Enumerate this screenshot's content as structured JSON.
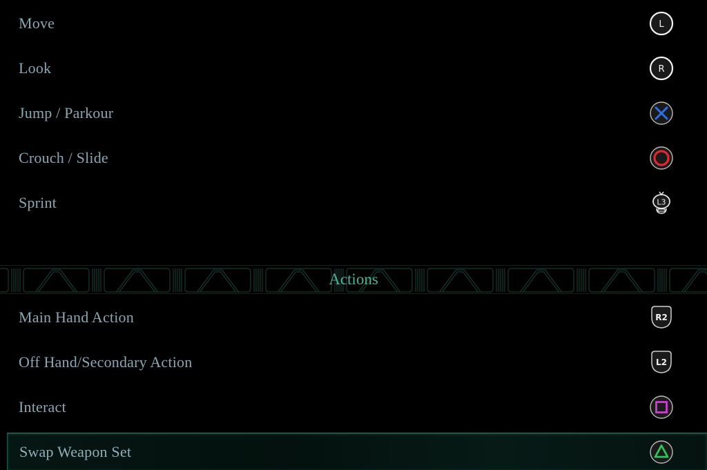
{
  "movement_rows": [
    {
      "label": "Move",
      "button": "L",
      "icon": "left-stick-icon"
    },
    {
      "label": "Look",
      "button": "R",
      "icon": "right-stick-icon"
    },
    {
      "label": "Jump / Parkour",
      "button": "Cross",
      "icon": "cross-button-icon"
    },
    {
      "label": "Crouch / Slide",
      "button": "Circle",
      "icon": "circle-button-icon"
    },
    {
      "label": "Sprint",
      "button": "L3",
      "icon": "l3-press-icon"
    }
  ],
  "actions_section": {
    "title": "Actions",
    "rows": [
      {
        "label": "Main Hand Action",
        "button": "R2",
        "icon": "r2-trigger-icon"
      },
      {
        "label": "Off Hand/Secondary Action",
        "button": "L2",
        "icon": "l2-trigger-icon"
      },
      {
        "label": "Interact",
        "button": "Square",
        "icon": "square-button-icon"
      },
      {
        "label": "Swap Weapon Set",
        "button": "Triangle",
        "icon": "triangle-button-icon",
        "selected": true
      }
    ]
  },
  "glyph_text": {
    "L": "L",
    "R": "R",
    "L3": "L3",
    "R2": "R2",
    "L2": "L2"
  },
  "colors": {
    "label_text": "#8aa7b4",
    "section_title": "#49b398",
    "cross": "#2f6fe8",
    "circle": "#e3262f",
    "square": "#d03cd6",
    "triangle": "#27c95a",
    "selected_border": "#2e7e6a"
  }
}
